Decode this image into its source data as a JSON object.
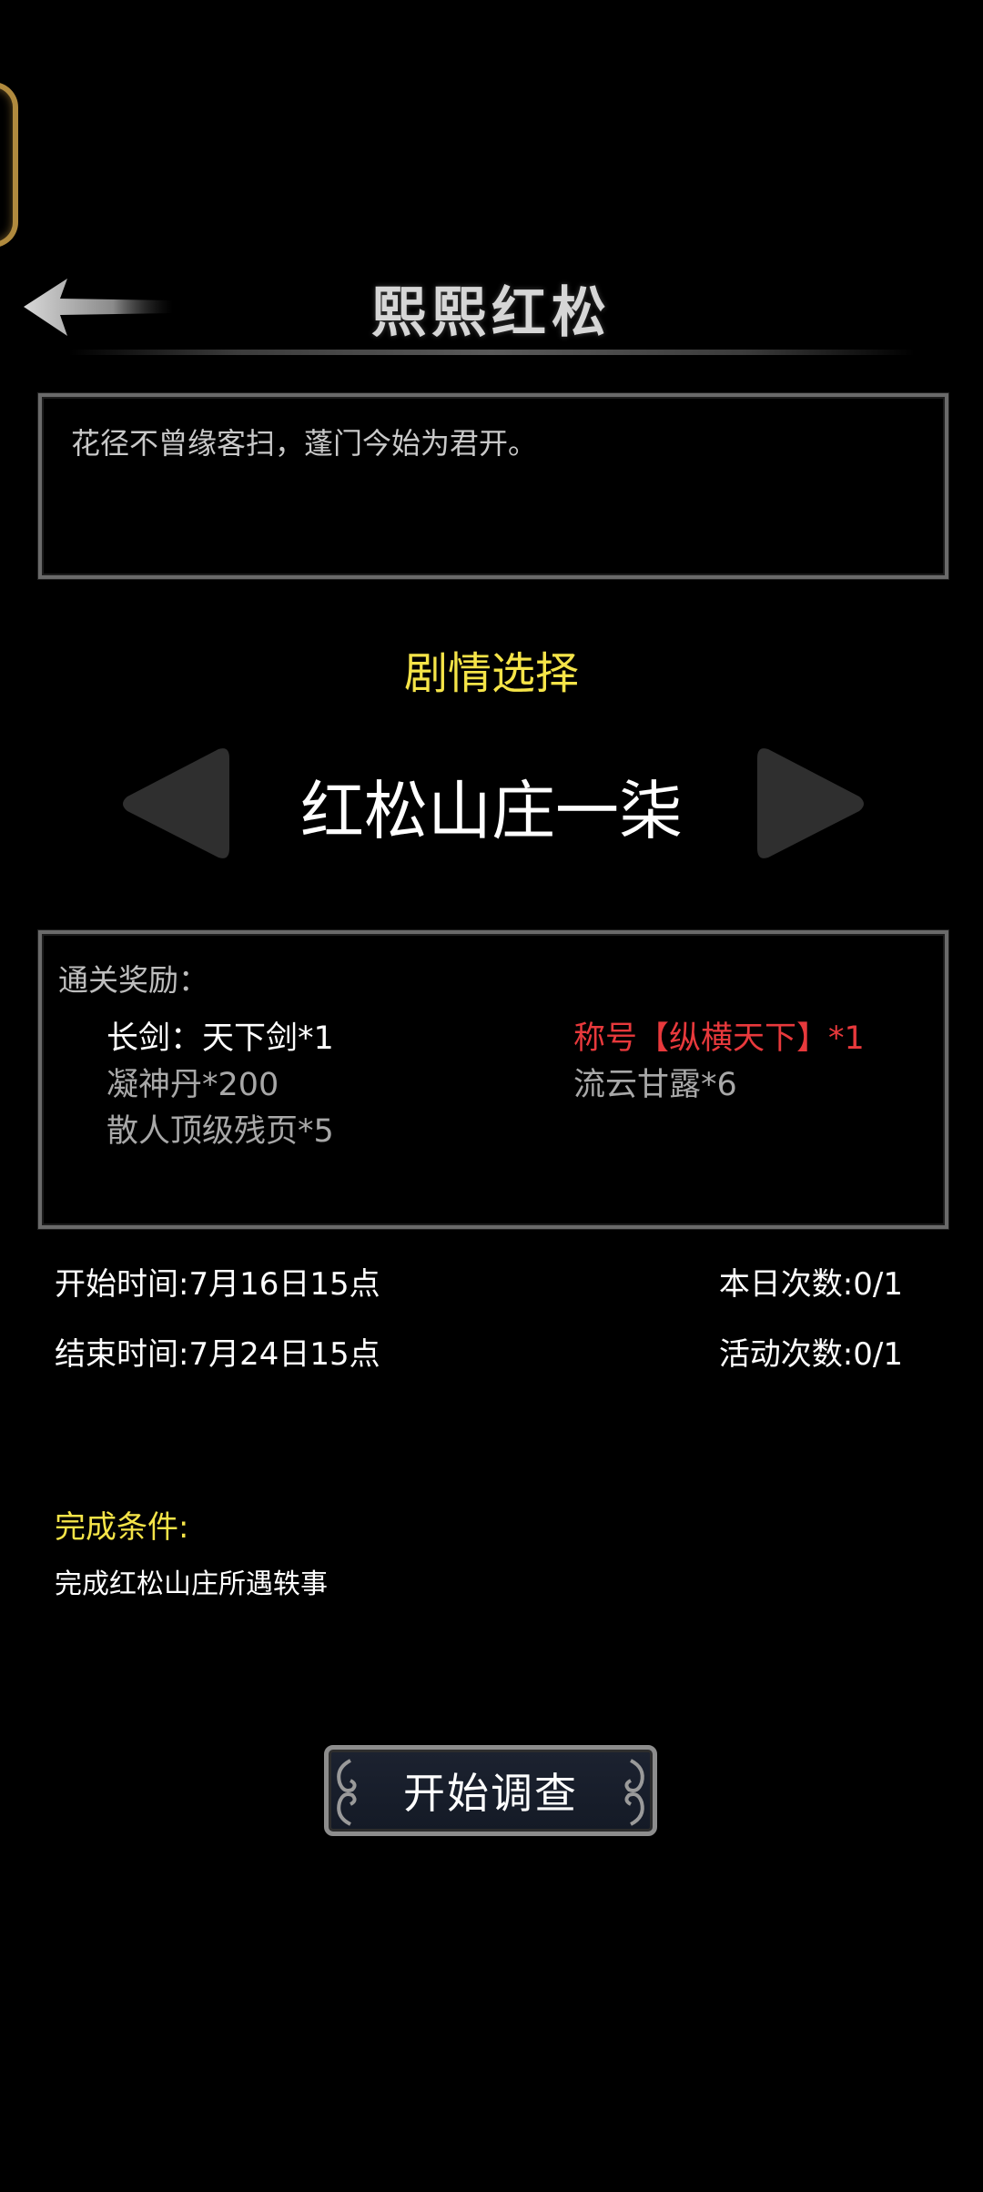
{
  "header": {
    "title": "熙熙红松"
  },
  "description": {
    "text": "花径不曾缘客扫，蓬门今始为君开。"
  },
  "plot": {
    "label": "剧情选择",
    "name": "红松山庄一柒"
  },
  "rewards": {
    "title": "通关奖励：",
    "items": [
      "长剑：天下剑*1",
      "称号【纵横天下】*1",
      "凝神丹*200",
      "流云甘露*6",
      "散人顶级残页*5"
    ]
  },
  "info": {
    "start_time": "开始时间:7月16日15点",
    "end_time": "结束时间:7月24日15点",
    "today_count": "本日次数:0/1",
    "event_count": "活动次数:0/1"
  },
  "condition": {
    "label": "完成条件:",
    "text": "完成红松山庄所遇轶事"
  },
  "actions": {
    "start_label": "开始调查"
  },
  "colors": {
    "highlight_yellow": "#f5e448",
    "title_red": "#e8393c",
    "frame_gold": "#b08a3e"
  }
}
